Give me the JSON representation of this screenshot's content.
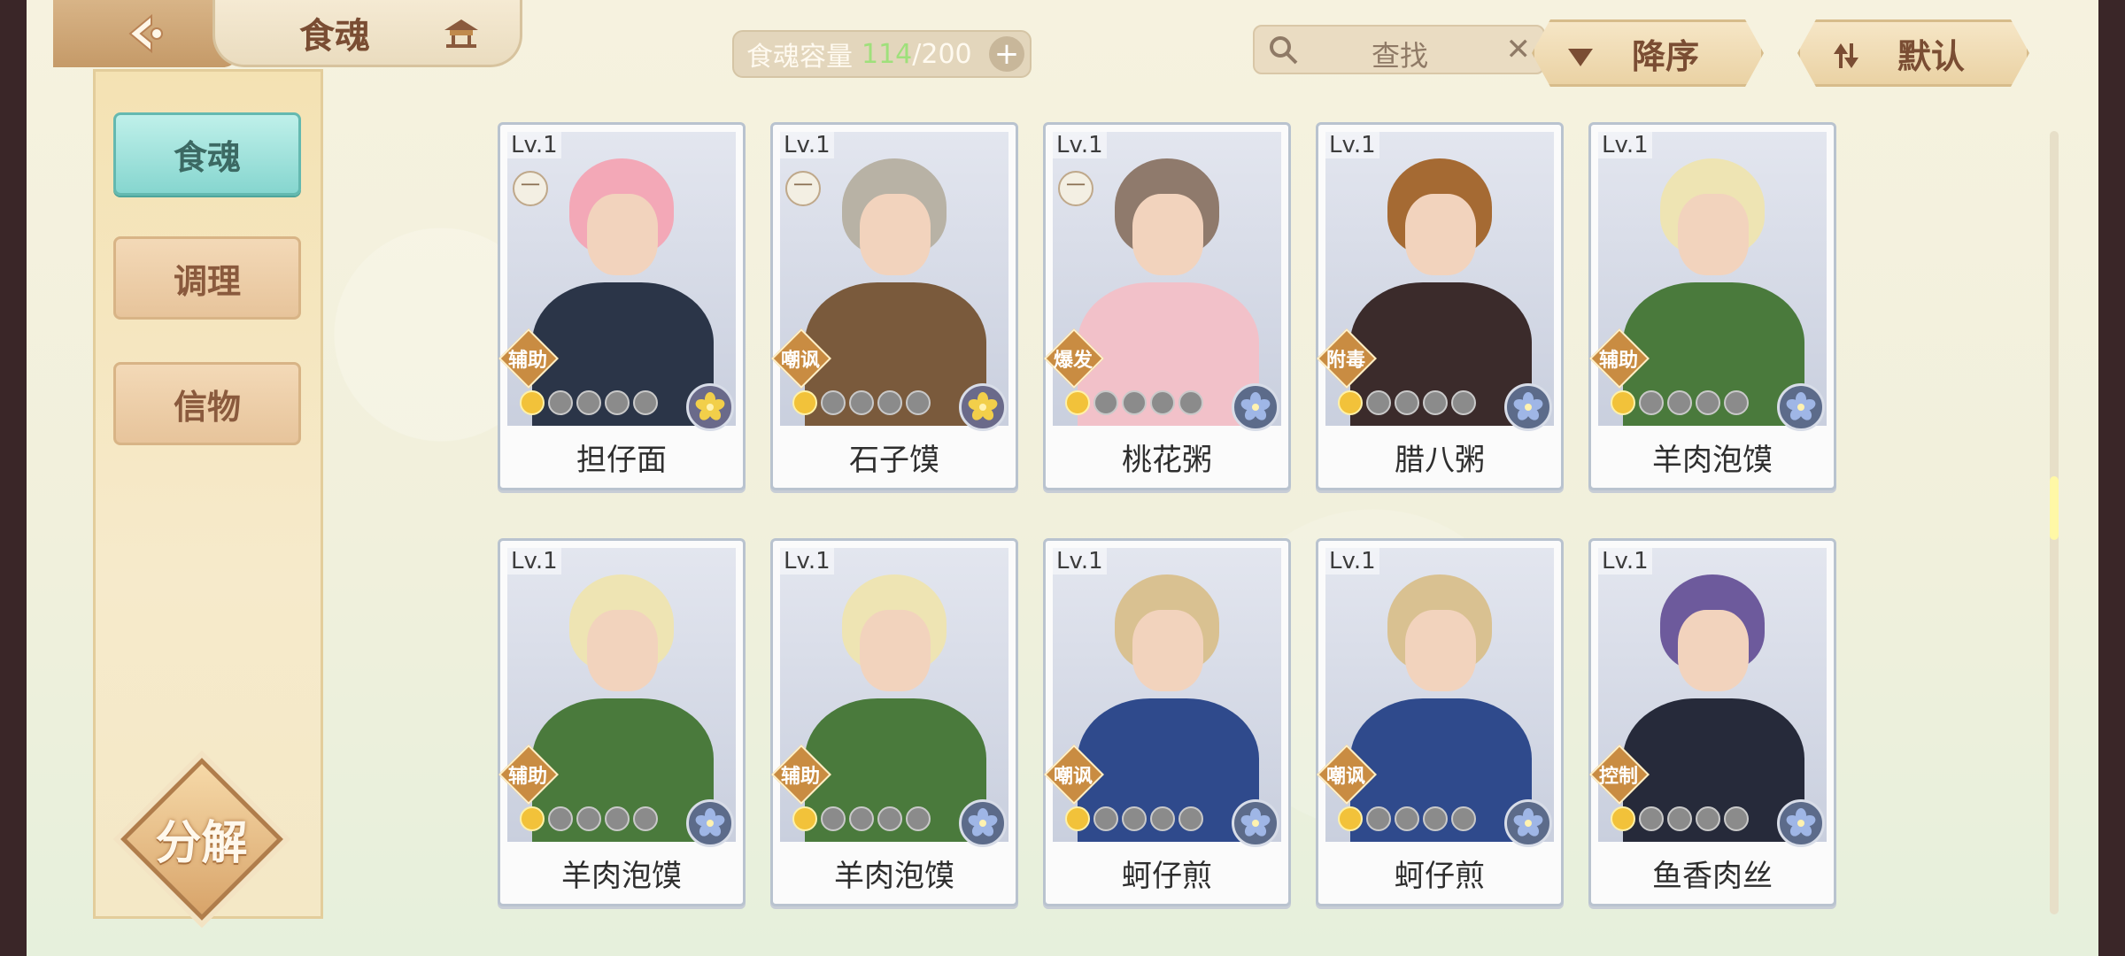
{
  "header": {
    "title": "食魂"
  },
  "sidebar": {
    "items": [
      {
        "label": "食魂",
        "active": true
      },
      {
        "label": "调理",
        "active": false
      },
      {
        "label": "信物",
        "active": false
      }
    ],
    "decompose_label": "分解"
  },
  "capacity": {
    "label": "食魂容量",
    "current": "114",
    "max": "/200"
  },
  "search": {
    "placeholder": "查找"
  },
  "sort": {
    "order_label": "降序",
    "default_label": "默认"
  },
  "colors": {
    "accent_teal": "#86d6cf",
    "role_orange": "#c98c42"
  },
  "cards": [
    {
      "level": "Lv.1",
      "role": "辅助",
      "name": "担仔面",
      "stars_on": 1,
      "has_badge": true,
      "hair": "#f3a8b7",
      "body": "#2b3548",
      "elem": "gold"
    },
    {
      "level": "Lv.1",
      "role": "嘲讽",
      "name": "石子馍",
      "stars_on": 1,
      "has_badge": true,
      "hair": "#b8b2a5",
      "body": "#7a5a3c",
      "elem": "gold"
    },
    {
      "level": "Lv.1",
      "role": "爆发",
      "name": "桃花粥",
      "stars_on": 1,
      "has_badge": true,
      "hair": "#8f7a6c",
      "body": "#f2c1c9",
      "elem": "blue"
    },
    {
      "level": "Lv.1",
      "role": "附毒",
      "name": "腊八粥",
      "stars_on": 1,
      "has_badge": false,
      "hair": "#a56a33",
      "body": "#3b2b2b",
      "elem": "blue"
    },
    {
      "level": "Lv.1",
      "role": "辅助",
      "name": "羊肉泡馍",
      "stars_on": 1,
      "has_badge": false,
      "hair": "#eee4b3",
      "body": "#4a7a3c",
      "elem": "blue"
    },
    {
      "level": "Lv.1",
      "role": "辅助",
      "name": "羊肉泡馍",
      "stars_on": 1,
      "has_badge": false,
      "hair": "#eee4b3",
      "body": "#4a7a3c",
      "elem": "blue"
    },
    {
      "level": "Lv.1",
      "role": "辅助",
      "name": "羊肉泡馍",
      "stars_on": 1,
      "has_badge": false,
      "hair": "#eee4b3",
      "body": "#4a7a3c",
      "elem": "blue"
    },
    {
      "level": "Lv.1",
      "role": "嘲讽",
      "name": "蚵仔煎",
      "stars_on": 1,
      "has_badge": false,
      "hair": "#d9c191",
      "body": "#2f4a8c",
      "elem": "blue"
    },
    {
      "level": "Lv.1",
      "role": "嘲讽",
      "name": "蚵仔煎",
      "stars_on": 1,
      "has_badge": false,
      "hair": "#d9c191",
      "body": "#2f4a8c",
      "elem": "blue"
    },
    {
      "level": "Lv.1",
      "role": "控制",
      "name": "鱼香肉丝",
      "stars_on": 1,
      "has_badge": false,
      "hair": "#6d5a9c",
      "body": "#262a3a",
      "elem": "blue"
    }
  ],
  "badge_glyph": "一"
}
